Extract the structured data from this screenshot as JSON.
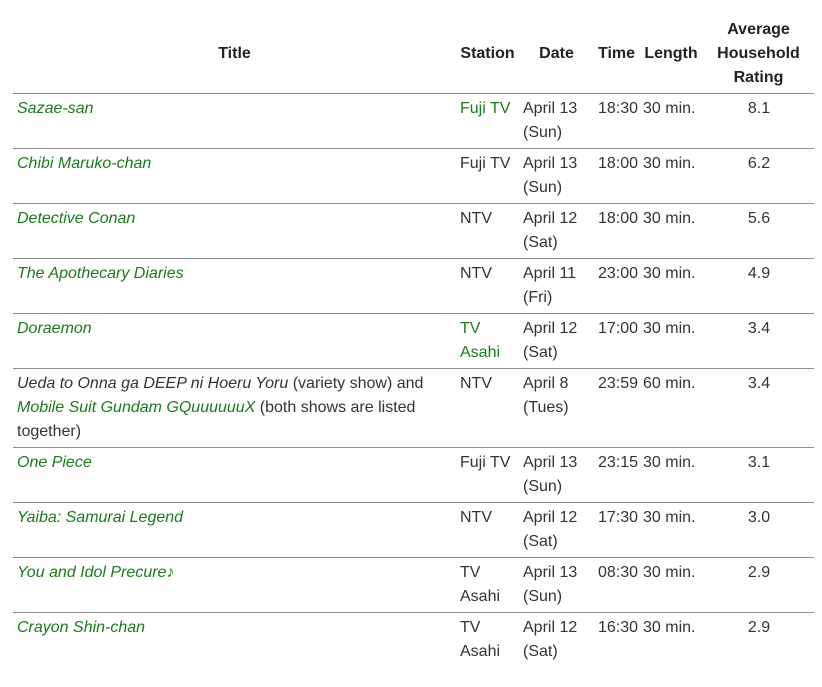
{
  "headers": {
    "title": "Title",
    "station": "Station",
    "date": "Date",
    "time": "Time",
    "length": "Length",
    "rating_line1": "Average",
    "rating_line2": "Household",
    "rating_line3": "Rating"
  },
  "rows": [
    {
      "title": "Sazae-san",
      "station": "Fuji TV",
      "station_link": true,
      "date_line1": "April 13",
      "date_line2": "(Sun)",
      "time": "18:30",
      "length": "30 min.",
      "rating": "8.1"
    },
    {
      "title": "Chibi Maruko-chan",
      "station": "Fuji TV",
      "station_link": false,
      "date_line1": "April 13",
      "date_line2": "(Sun)",
      "time": "18:00",
      "length": "30 min.",
      "rating": "6.2"
    },
    {
      "title": "Detective Conan",
      "station": "NTV",
      "station_link": false,
      "date_line1": "April 12",
      "date_line2": "(Sat)",
      "time": "18:00",
      "length": "30 min.",
      "rating": "5.6"
    },
    {
      "title": "The Apothecary Diaries",
      "station": "NTV",
      "station_link": false,
      "date_line1": "April 11",
      "date_line2": "(Fri)",
      "time": "23:00",
      "length": "30 min.",
      "rating": "4.9"
    },
    {
      "title": "Doraemon",
      "station": "TV Asahi",
      "station_link": true,
      "date_line1": "April 12",
      "date_line2": "(Sat)",
      "time": "17:00",
      "length": "30 min.",
      "rating": "3.4"
    },
    {
      "title_parts": {
        "part1": "Ueda to Onna ga DEEP ni Hoeru Yoru",
        "part2": " (variety show) and ",
        "part3": "Mobile Suit Gundam GQuuuuuuX",
        "part4": " (both shows are listed together)"
      },
      "station": "NTV",
      "station_link": false,
      "date_line1": "April 8",
      "date_line2": "(Tues)",
      "time": "23:59",
      "length": "60 min.",
      "rating": "3.4"
    },
    {
      "title": "One Piece",
      "station": "Fuji TV",
      "station_link": false,
      "date_line1": "April 13",
      "date_line2": "(Sun)",
      "time": "23:15",
      "length": "30 min.",
      "rating": "3.1"
    },
    {
      "title": "Yaiba: Samurai Legend",
      "station": "NTV",
      "station_link": false,
      "date_line1": "April 12",
      "date_line2": "(Sat)",
      "time": "17:30",
      "length": "30 min.",
      "rating": "3.0"
    },
    {
      "title": "You and Idol Precure♪",
      "station": "TV Asahi",
      "station_link": false,
      "date_line1": "April 13",
      "date_line2": "(Sun)",
      "time": "08:30",
      "length": "30 min.",
      "rating": "2.9"
    },
    {
      "title": "Crayon Shin-chan",
      "station": "TV Asahi",
      "station_link": false,
      "date_line1": "April 12",
      "date_line2": "(Sat)",
      "time": "16:30",
      "length": "30 min.",
      "rating": "2.9"
    }
  ],
  "colors": {
    "link": "#1b7a1b",
    "text": "#333333",
    "rule": "#8c8c8c"
  }
}
